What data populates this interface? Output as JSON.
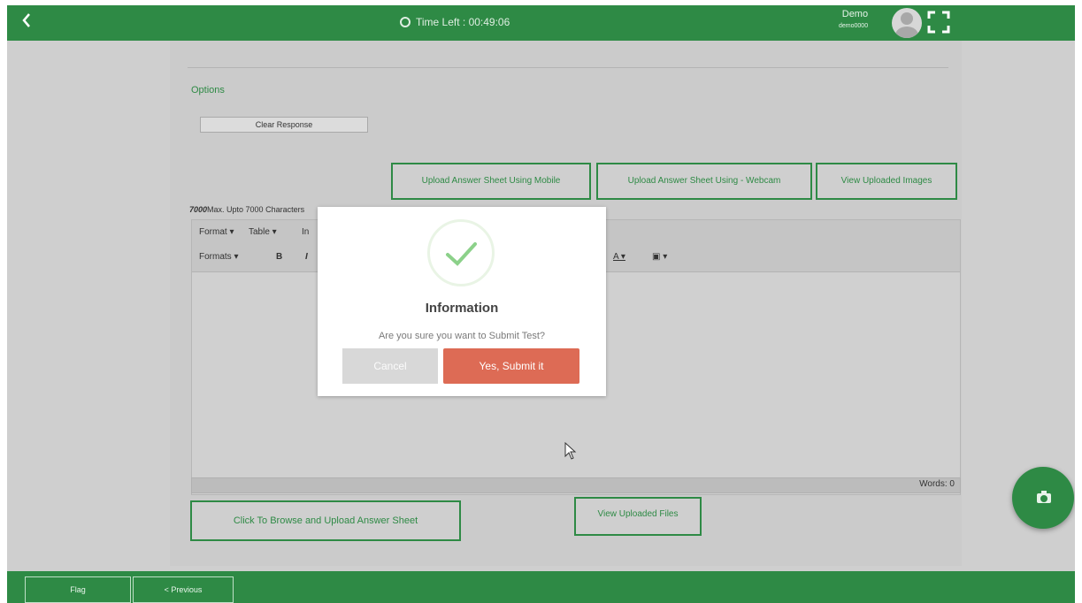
{
  "colors": {
    "brand_green": "#2e8a45",
    "overlay_gray": "#cfcfcf",
    "submit_red": "#dd6b55",
    "success_check": "#8cd18a"
  },
  "header": {
    "back_icon": "chevron-left-icon",
    "timer_icon": "clock-icon",
    "timer_text": "Time Left : 00:49:06",
    "user_name": "Demo",
    "user_id": "demo0000",
    "fullscreen_icon": "fullscreen-icon"
  },
  "question": {
    "options_label": "Options",
    "clear_response_label": "Clear Response",
    "upload_mobile_label": "Upload Answer Sheet Using Mobile",
    "upload_webcam_label": "Upload Answer Sheet Using - Webcam",
    "view_images_label": "View Uploaded Images",
    "char_limit_number": "7000",
    "char_limit_text": "Max. Upto 7000 Characters",
    "toolbar": {
      "format_menu": "Format ▾",
      "table_menu": "Table ▾",
      "insert_menu": "In",
      "formats_menu": "Formats ▾",
      "bold": "B",
      "italic": "I",
      "text_color": "A ▾",
      "bg_color": "▣ ▾"
    },
    "words_label": "Words: 0",
    "browse_upload_label": "Click To Browse and Upload Answer Sheet",
    "view_files_label": "View Uploaded Files"
  },
  "footer": {
    "flag_label": "Flag",
    "previous_label": "< Previous"
  },
  "fab_icon": "camera-icon",
  "modal": {
    "icon": "success-check-icon",
    "title": "Information",
    "message": "Are you sure you want to Submit Test?",
    "cancel_label": "Cancel",
    "confirm_label": "Yes, Submit it"
  }
}
